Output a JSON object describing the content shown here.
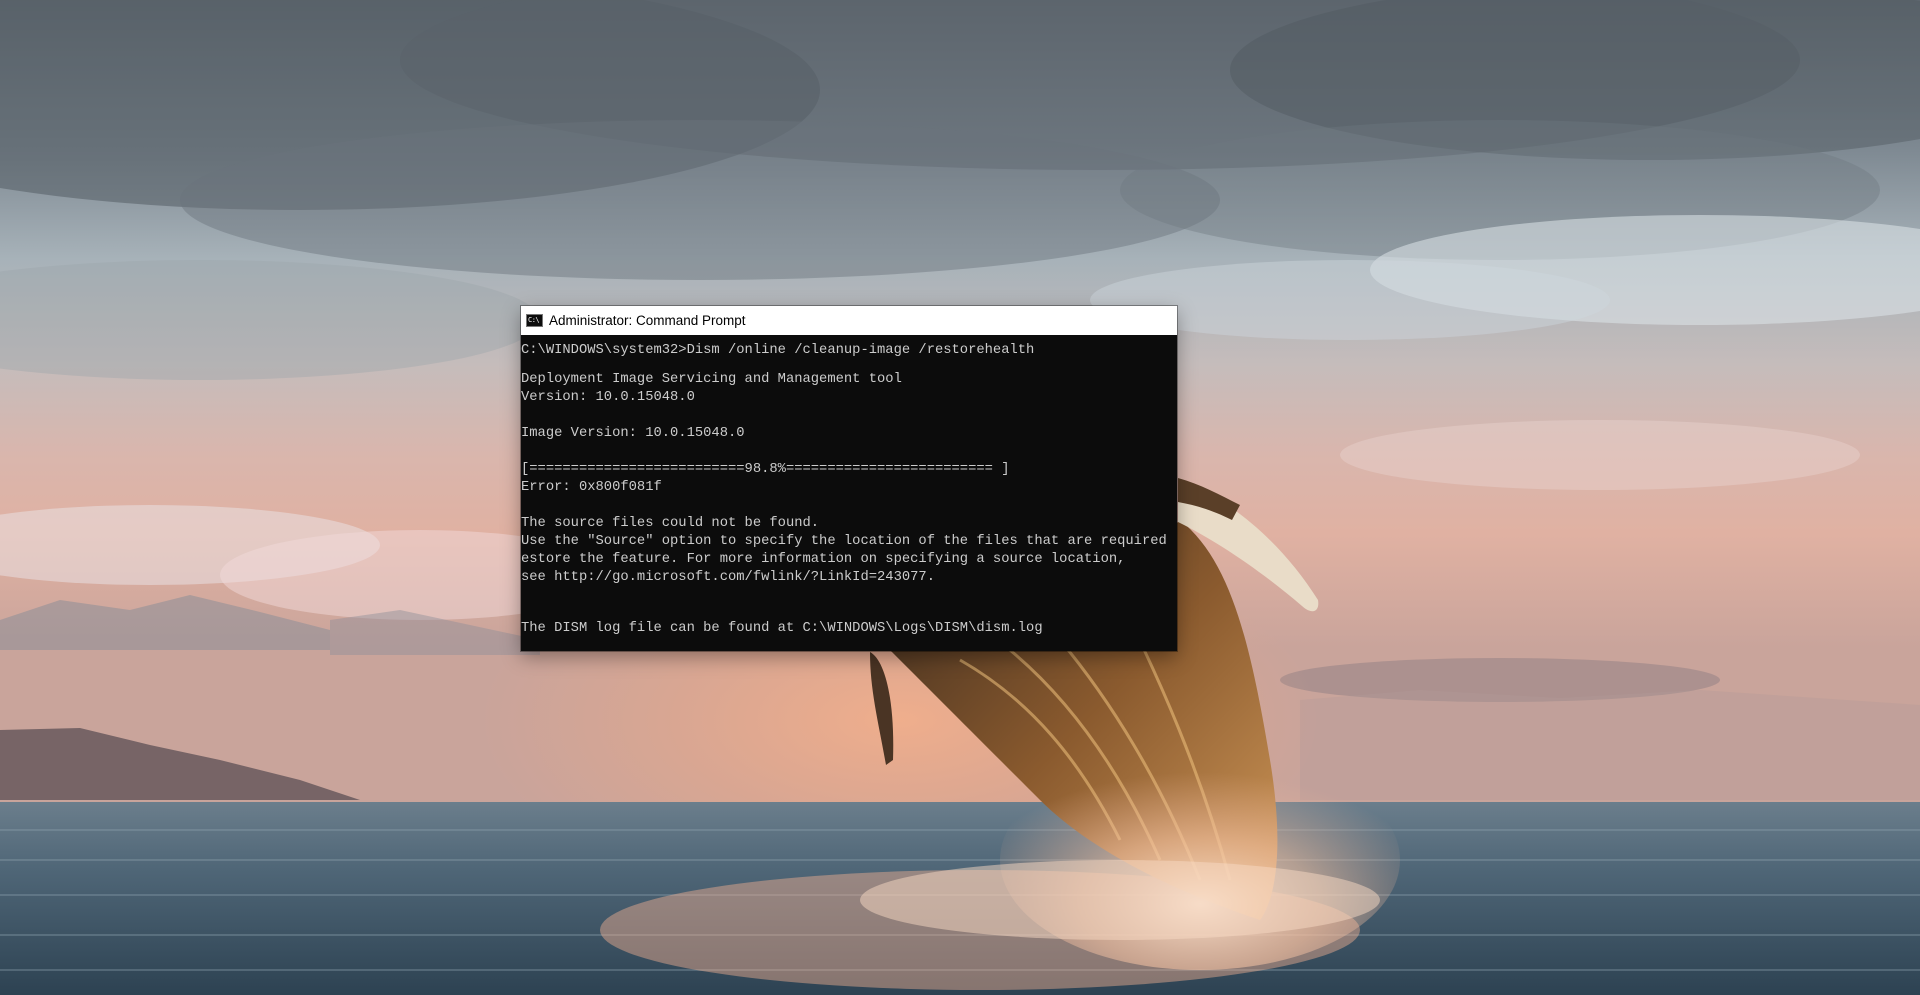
{
  "window": {
    "title": "Administrator: Command Prompt",
    "icon": "cmd-prompt-icon",
    "icon_glyph": "C:\\"
  },
  "console": {
    "lines": [
      "C:\\WINDOWS\\system32>Dism /online /cleanup-image /restorehealth",
      "",
      "Deployment Image Servicing and Management tool",
      "Version: 10.0.15048.0",
      "",
      "Image Version: 10.0.15048.0",
      "",
      "[==========================98.8%========================= ]",
      "Error: 0x800f081f",
      "",
      "The source files could not be found.",
      "Use the \"Source\" option to specify the location of the files that are required",
      "estore the feature. For more information on specifying a source location,",
      "see http://go.microsoft.com/fwlink/?LinkId=243077.",
      "",
      "The DISM log file can be found at C:\\WINDOWS\\Logs\\DISM\\dism.log"
    ],
    "progress_percent": 98.8
  },
  "colors": {
    "console_background": "#0c0c0c",
    "console_text": "#cccccc",
    "titlebar_background": "#ffffff"
  }
}
